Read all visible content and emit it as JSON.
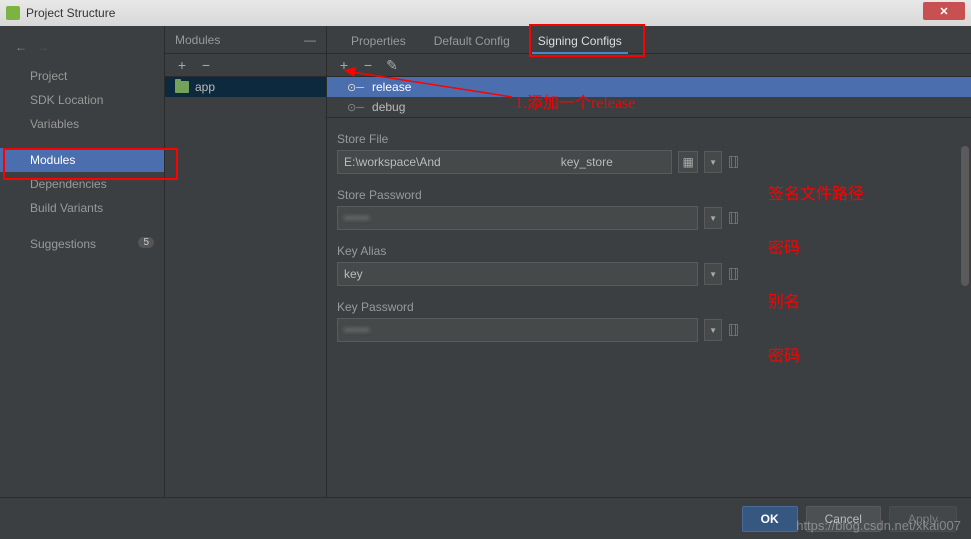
{
  "titlebar": {
    "title": "Project Structure"
  },
  "leftNav": {
    "items": [
      {
        "label": "Project"
      },
      {
        "label": "SDK Location"
      },
      {
        "label": "Variables"
      },
      {
        "label": "Modules",
        "selected": true
      },
      {
        "label": "Dependencies"
      },
      {
        "label": "Build Variants"
      },
      {
        "label": "Suggestions",
        "badge": "5"
      }
    ]
  },
  "modules": {
    "title": "Modules",
    "items": [
      {
        "label": "app",
        "selected": true
      }
    ]
  },
  "tabs": [
    {
      "label": "Properties"
    },
    {
      "label": "Default Config"
    },
    {
      "label": "Signing Configs",
      "active": true
    }
  ],
  "configs": [
    {
      "label": "release",
      "selected": true
    },
    {
      "label": "debug"
    }
  ],
  "form": {
    "storeFile": {
      "label": "Store File",
      "value": "E:\\workspace\\And                                    key_store"
    },
    "storePassword": {
      "label": "Store Password",
      "value": "••••••"
    },
    "keyAlias": {
      "label": "Key Alias",
      "value": "key"
    },
    "keyPassword": {
      "label": "Key Password",
      "value": "••••••"
    }
  },
  "buttons": {
    "ok": "OK",
    "cancel": "Cancel",
    "apply": "Apply"
  },
  "annotations": {
    "a1": "1.添加一个release",
    "a2": "签名文件路径",
    "a3": "密码",
    "a4": "别名",
    "a5": "密码"
  },
  "watermark": "https://blog.csdn.net/xkai007"
}
